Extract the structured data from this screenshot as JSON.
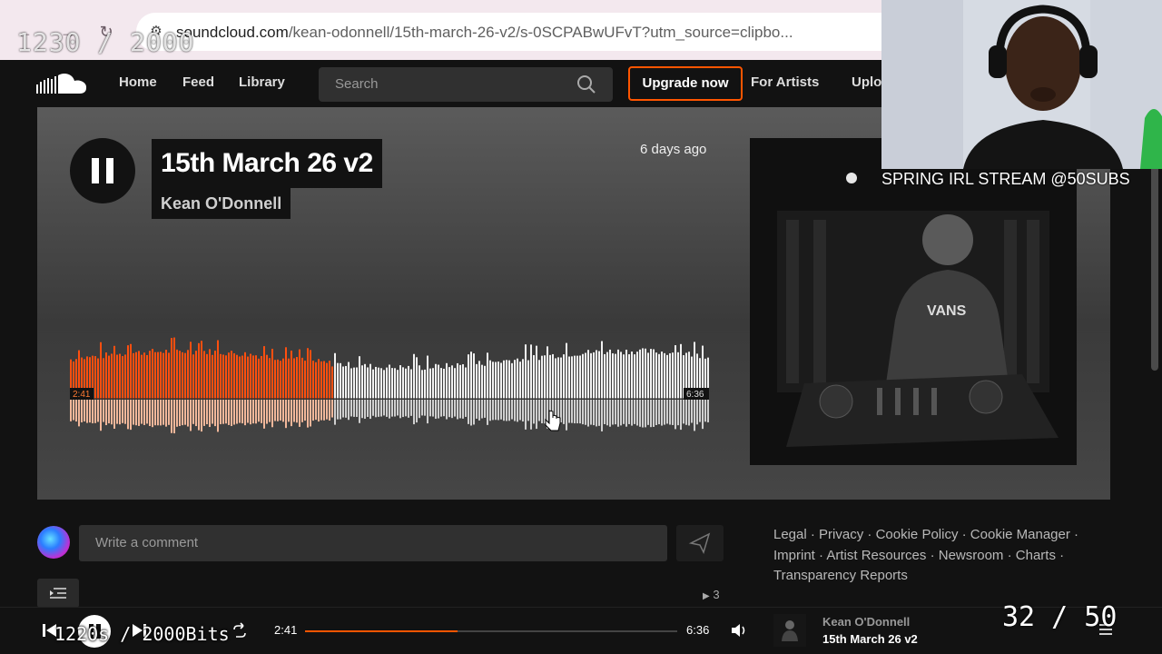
{
  "browser": {
    "url_host": "soundcloud.com",
    "url_path": "/kean-odonnell/15th-march-26-v2/s-0SCPABwUFvT?utm_source=clipbo...",
    "goal_counter": "1230 / 2000"
  },
  "nav": {
    "home": "Home",
    "feed": "Feed",
    "library": "Library",
    "search_placeholder": "Search",
    "upgrade": "Upgrade now",
    "for_artists": "For Artists",
    "upload": "Upload"
  },
  "track": {
    "title": "15th March 26 v2",
    "artist": "Kean O'Donnell",
    "posted": "6 days ago",
    "current_time": "2:41",
    "duration": "6:36",
    "progress": 0.41,
    "plays": "3",
    "state": "playing"
  },
  "comment": {
    "placeholder": "Write a comment"
  },
  "footer": {
    "links": [
      "Legal",
      "Privacy",
      "Cookie Policy",
      "Cookie Manager",
      "Imprint",
      "Artist Resources",
      "Newsroom",
      "Charts",
      "Transparency Reports"
    ]
  },
  "player": {
    "current_time": "2:41",
    "duration": "6:36",
    "artist": "Kean O'Donnell",
    "title": "15th March 26 v2"
  },
  "overlay": {
    "stream_label": "SPRING IRL STREAM @50SUBS",
    "bits": "1220s / 2000Bits",
    "subs": "32 / 50"
  },
  "colors": {
    "accent": "#ff5500",
    "background": "#121212"
  }
}
